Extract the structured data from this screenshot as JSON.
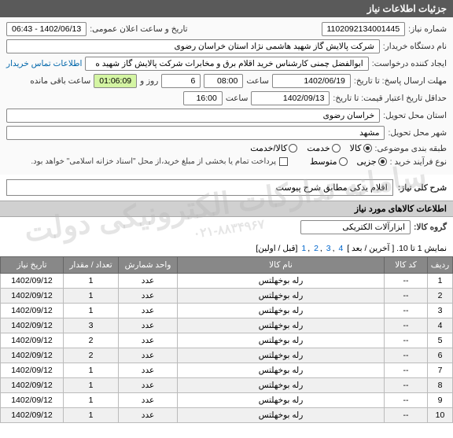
{
  "header": "جزئیات اطلاعات نیاز",
  "labels": {
    "reqNo": "شماره نیاز:",
    "announceDate": "تاریخ و ساعت اعلان عمومی:",
    "buyerOrg": "نام دستگاه خریدار:",
    "requester": "ایجاد کننده درخواست:",
    "buyerContact": "اطلاعات تماس خریدار",
    "deadline": "مهلت ارسال پاسخ: تا تاریخ:",
    "hour": "ساعت",
    "dayAnd": "روز و",
    "remain": "ساعت باقی مانده",
    "validFrom": "حداقل تاریخ اعتبار قیمت: تا تاریخ:",
    "province": "استان محل تحویل:",
    "city": "شهر محل تحویل:",
    "topic": "طبقه بندی موضوعی:",
    "goods": "کالا",
    "service": "خدمت",
    "goodsService": "کالا/خدمت",
    "buyType": "نوع فرآیند خرید :",
    "partial": "جزیی",
    "medium": "متوسط",
    "payNote": "پرداخت تمام یا بخشی از مبلغ خرید،از محل \"اسناد خزانه اسلامی\" خواهد بود.",
    "descTitle": "شرح کلی نیاز:",
    "itemsTitle": "اطلاعات کالاهای مورد نیاز",
    "groupLbl": "گروه کالا:",
    "pagerPrefix": "نمایش 1 تا 10. [ آخرین / بعد ]",
    "pagerSuffix": "[قبل / اولین]"
  },
  "values": {
    "reqNo": "1102092134001445",
    "announceDate": "1402/06/13 - 06:43",
    "buyerOrg": "شرکت پالایش گاز شهید هاشمی نژاد   استان خراسان رضوی",
    "requester": "ابوالفضل چمنی کارشناس خرید اقلام برق و مخابرات شرکت پالایش گاز شهید ه",
    "deadlineDate": "1402/06/19",
    "deadlineHour": "08:00",
    "days": "6",
    "remain": "01:06:09",
    "validDate": "1402/09/13",
    "validHour": "16:00",
    "province": "خراسان رضوی",
    "city": "مشهد",
    "desc": "اقلام یدکی مطابق شرح پیوست",
    "group": "ابزارآلات الکتریکی"
  },
  "pagerPages": [
    "4",
    "3",
    "2",
    "1"
  ],
  "table": {
    "headers": [
      "ردیف",
      "کد کالا",
      "نام کالا",
      "واحد شمارش",
      "تعداد / مقدار",
      "تاریخ نیاز"
    ],
    "rows": [
      {
        "idx": "1",
        "code": "--",
        "name": "رله بوخهلتس",
        "unit": "عدد",
        "qty": "1",
        "date": "1402/09/12"
      },
      {
        "idx": "2",
        "code": "--",
        "name": "رله بوخهلتس",
        "unit": "عدد",
        "qty": "1",
        "date": "1402/09/12"
      },
      {
        "idx": "3",
        "code": "--",
        "name": "رله بوخهلتس",
        "unit": "عدد",
        "qty": "1",
        "date": "1402/09/12"
      },
      {
        "idx": "4",
        "code": "--",
        "name": "رله بوخهلتس",
        "unit": "عدد",
        "qty": "3",
        "date": "1402/09/12"
      },
      {
        "idx": "5",
        "code": "--",
        "name": "رله بوخهلتس",
        "unit": "عدد",
        "qty": "2",
        "date": "1402/09/12"
      },
      {
        "idx": "6",
        "code": "--",
        "name": "رله بوخهلتس",
        "unit": "عدد",
        "qty": "2",
        "date": "1402/09/12"
      },
      {
        "idx": "7",
        "code": "--",
        "name": "رله بوخهلتس",
        "unit": "عدد",
        "qty": "1",
        "date": "1402/09/12"
      },
      {
        "idx": "8",
        "code": "--",
        "name": "رله بوخهلتس",
        "unit": "عدد",
        "qty": "1",
        "date": "1402/09/12"
      },
      {
        "idx": "9",
        "code": "--",
        "name": "رله بوخهلتس",
        "unit": "عدد",
        "qty": "1",
        "date": "1402/09/12"
      },
      {
        "idx": "10",
        "code": "--",
        "name": "رله بوخهلتس",
        "unit": "عدد",
        "qty": "1",
        "date": "1402/09/12"
      }
    ]
  },
  "watermark": {
    "main": "سامانه تدارکات الکترونیکی دولت",
    "sub": "۰۲۱-۸۸۳۴۹۶۷"
  }
}
